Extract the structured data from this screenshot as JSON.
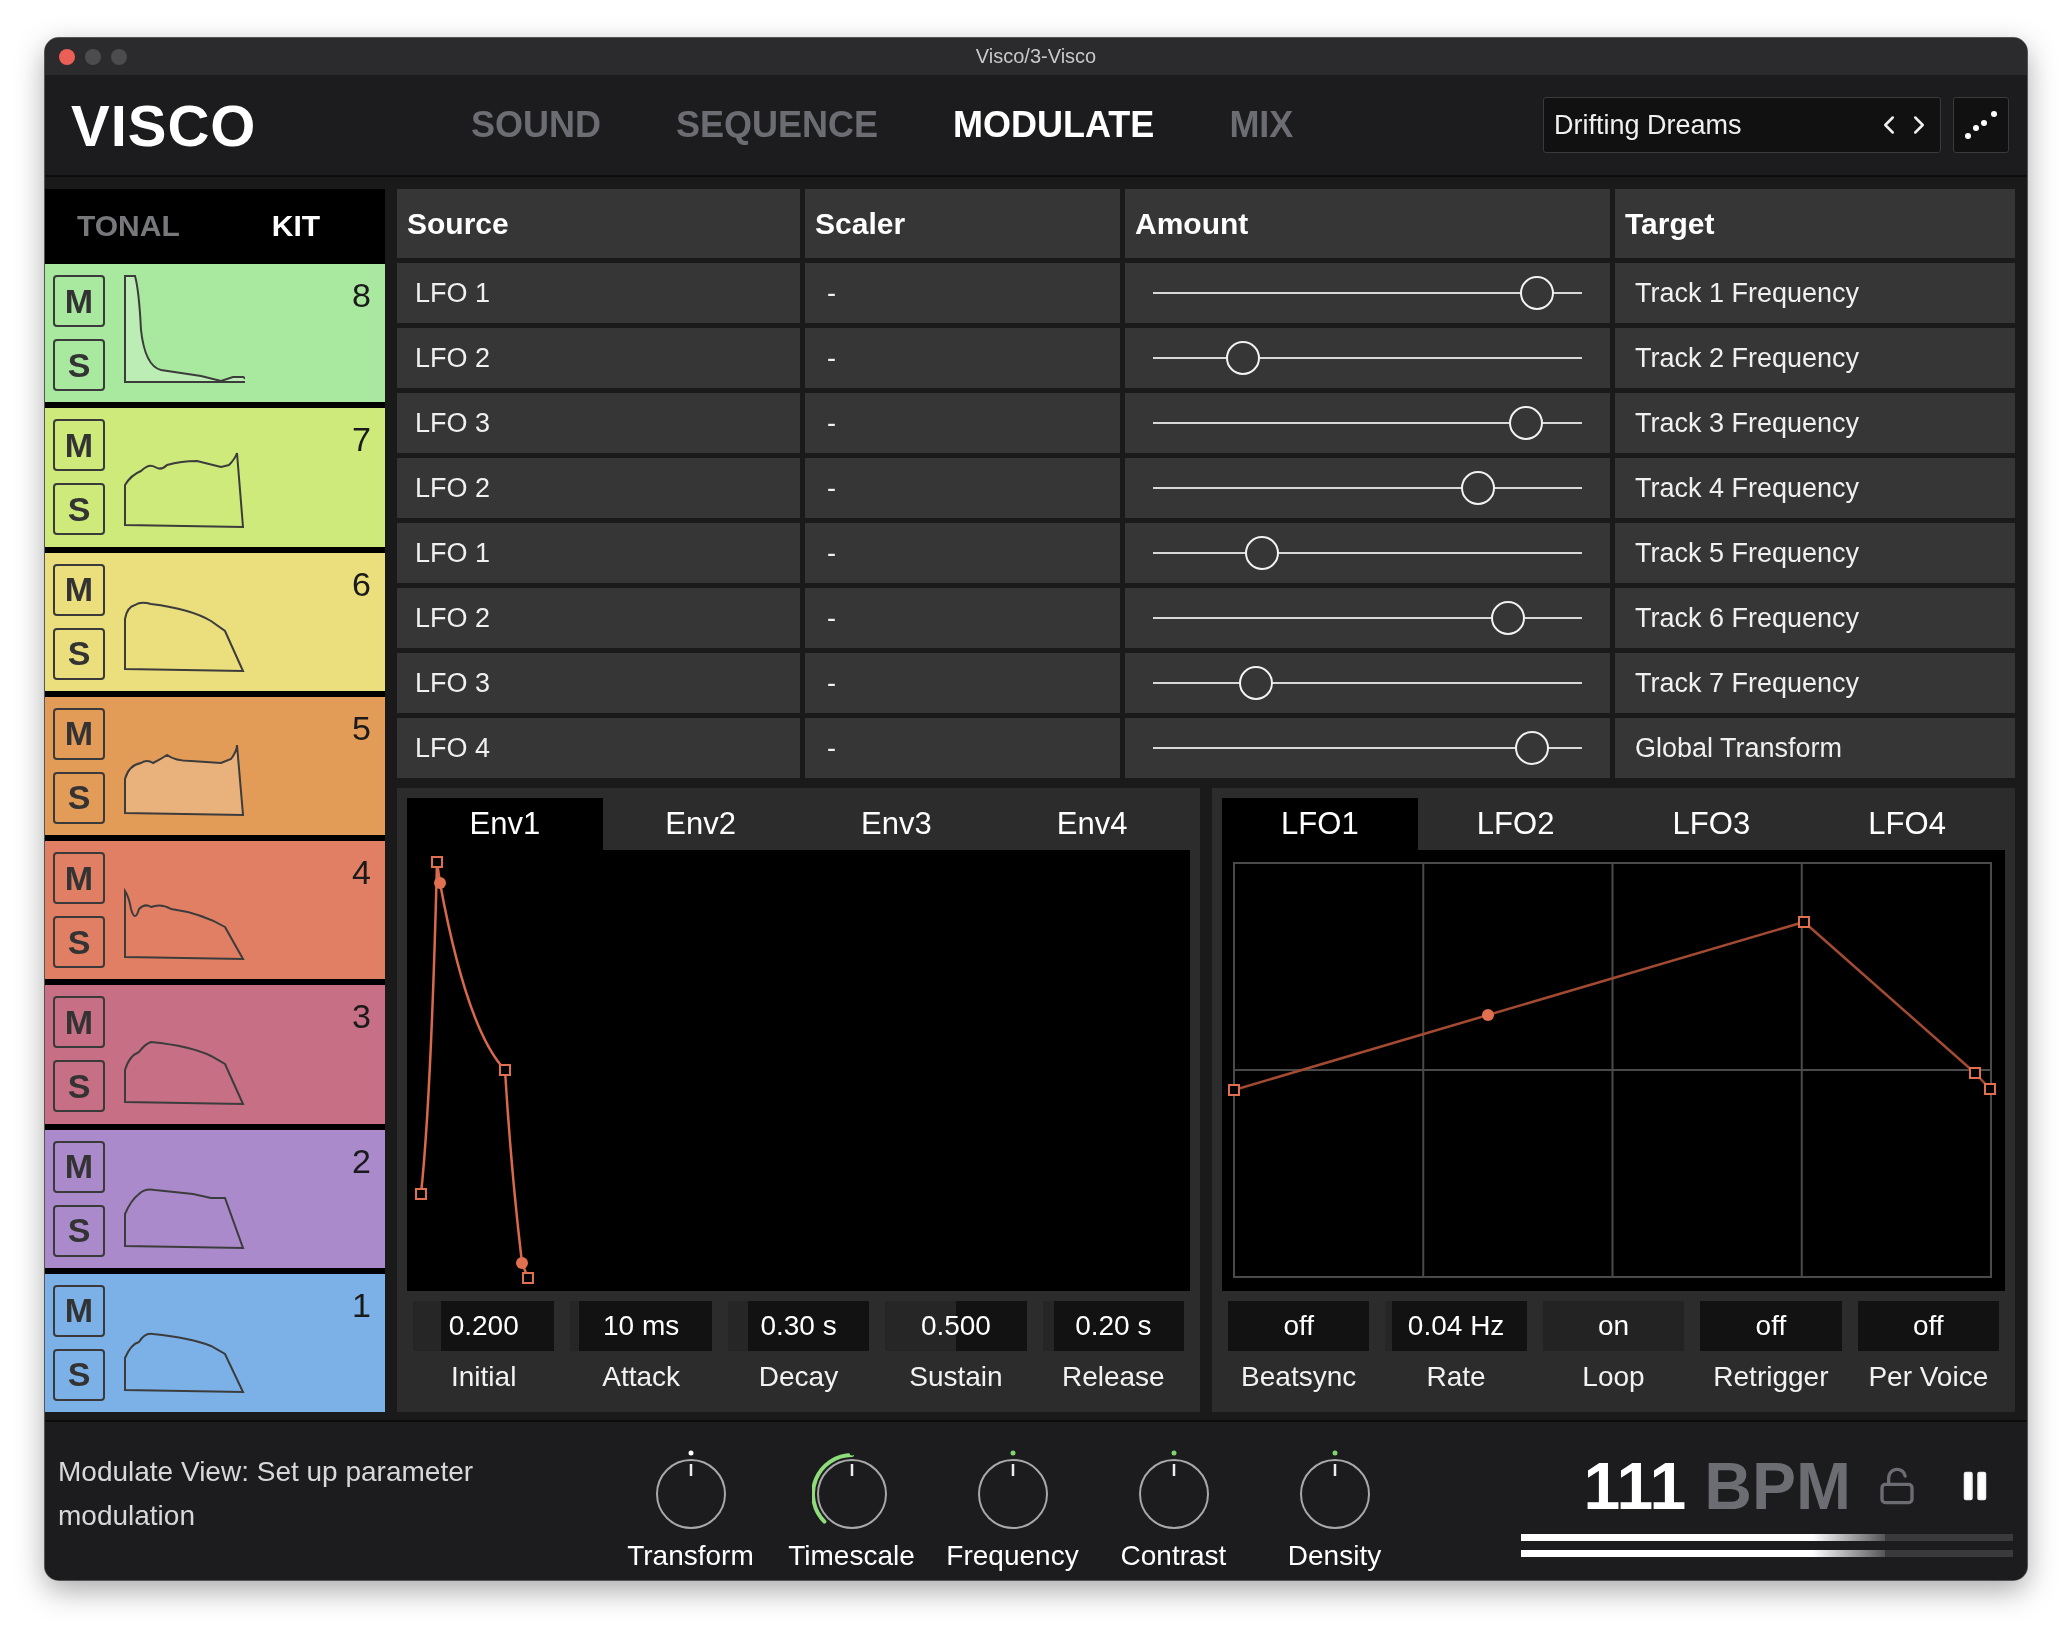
{
  "window": {
    "title": "Visco/3-Visco"
  },
  "logo": "VISCO",
  "nav_tabs": [
    {
      "label": "SOUND",
      "selected": false
    },
    {
      "label": "SEQUENCE",
      "selected": false
    },
    {
      "label": "MODULATE",
      "selected": true
    },
    {
      "label": "MIX",
      "selected": false
    }
  ],
  "preset": {
    "name": "Drifting Dreams"
  },
  "track_tabs": [
    {
      "label": "TONAL",
      "selected": false
    },
    {
      "label": "KIT",
      "selected": true
    }
  ],
  "tracks": [
    {
      "number": "8",
      "color": "#a9e89f",
      "mute": "M",
      "solo": "S",
      "filled": true
    },
    {
      "number": "7",
      "color": "#cdea7a",
      "mute": "M",
      "solo": "S",
      "filled": false
    },
    {
      "number": "6",
      "color": "#eade7d",
      "mute": "M",
      "solo": "S",
      "filled": false
    },
    {
      "number": "5",
      "color": "#e39b58",
      "mute": "M",
      "solo": "S",
      "filled": true
    },
    {
      "number": "4",
      "color": "#e07f63",
      "mute": "M",
      "solo": "S",
      "filled": false
    },
    {
      "number": "3",
      "color": "#c66f85",
      "mute": "M",
      "solo": "S",
      "filled": false
    },
    {
      "number": "2",
      "color": "#ab8acc",
      "mute": "M",
      "solo": "S",
      "filled": false
    },
    {
      "number": "1",
      "color": "#7bb1e7",
      "mute": "M",
      "solo": "S",
      "filled": false
    }
  ],
  "modulation": {
    "columns": [
      "Source",
      "Scaler",
      "Amount",
      "Target"
    ],
    "rows": [
      {
        "source": "LFO 1",
        "scaler": "-",
        "level": 0.895,
        "target": "Track 1 Frequency"
      },
      {
        "source": "LFO 2",
        "scaler": "-",
        "level": 0.21,
        "target": "Track 2 Frequency"
      },
      {
        "source": "LFO 3",
        "scaler": "-",
        "level": 0.87,
        "target": "Track 3 Frequency"
      },
      {
        "source": "LFO 2",
        "scaler": "-",
        "level": 0.757,
        "target": "Track 4 Frequency"
      },
      {
        "source": "LFO 1",
        "scaler": "-",
        "level": 0.255,
        "target": "Track 5 Frequency"
      },
      {
        "source": "LFO 2",
        "scaler": "-",
        "level": 0.828,
        "target": "Track 6 Frequency"
      },
      {
        "source": "LFO 3",
        "scaler": "-",
        "level": 0.24,
        "target": "Track 7 Frequency"
      },
      {
        "source": "LFO 4",
        "scaler": "-",
        "level": 0.883,
        "target": "Global Transform"
      }
    ]
  },
  "envelope": {
    "tabs": [
      {
        "label": "Env1",
        "selected": true
      },
      {
        "label": "Env2",
        "selected": false
      },
      {
        "label": "Env3",
        "selected": false
      },
      {
        "label": "Env4",
        "selected": false
      }
    ],
    "params": [
      {
        "value": "0.200",
        "label": "Initial",
        "level": 0.2
      },
      {
        "value": "10 ms",
        "label": "Attack",
        "level": 0.06
      },
      {
        "value": "0.30 s",
        "label": "Decay",
        "level": 0.14
      },
      {
        "value": "0.500",
        "label": "Sustain",
        "level": 0.5
      },
      {
        "value": "0.20 s",
        "label": "Release",
        "level": 0.08
      }
    ]
  },
  "lfo": {
    "tabs": [
      {
        "label": "LFO1",
        "selected": true
      },
      {
        "label": "LFO2",
        "selected": false
      },
      {
        "label": "LFO3",
        "selected": false
      },
      {
        "label": "LFO4",
        "selected": false
      }
    ],
    "params": [
      {
        "kind": "toggle",
        "value": "off",
        "label": "Beatsync",
        "on": false
      },
      {
        "kind": "value",
        "value": "0.04 Hz",
        "label": "Rate",
        "level": 0.05
      },
      {
        "kind": "toggle",
        "value": "on",
        "label": "Loop",
        "on": true
      },
      {
        "kind": "toggle",
        "value": "off",
        "label": "Retrigger",
        "on": false
      },
      {
        "kind": "toggle",
        "value": "off",
        "label": "Per Voice",
        "on": false
      }
    ]
  },
  "status": "Modulate View: Set up parameter modulation",
  "knobs": [
    {
      "label": "Transform",
      "level": 0.5,
      "color": "#ffffff",
      "modulated": false
    },
    {
      "label": "Timescale",
      "level": 0.5,
      "color": "#1e1e1e",
      "modulated": true
    },
    {
      "label": "Frequency",
      "level": 0.5,
      "color": "#7fd46e",
      "modulated": false
    },
    {
      "label": "Contrast",
      "level": 0.5,
      "color": "#7fd46e",
      "modulated": false
    },
    {
      "label": "Density",
      "level": 0.5,
      "color": "#7fd46e",
      "modulated": false
    }
  ],
  "tempo": {
    "value": "111",
    "unit": "BPM",
    "locked": false
  },
  "meters": [
    {
      "level": 0.74
    },
    {
      "level": 0.74
    }
  ]
}
